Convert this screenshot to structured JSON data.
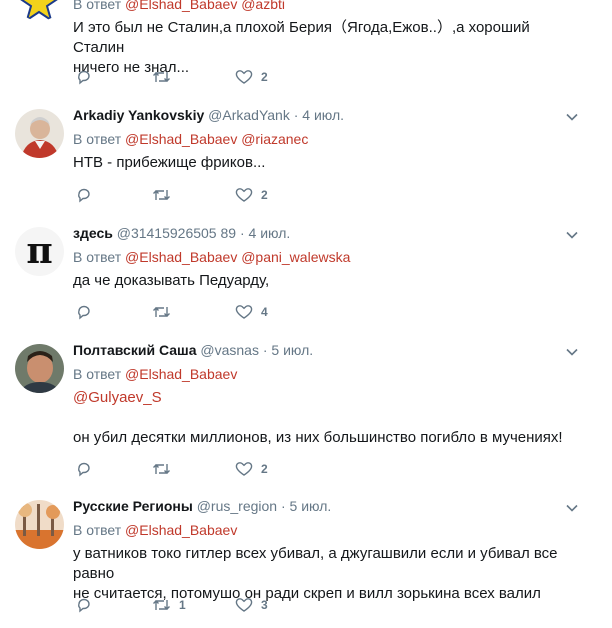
{
  "tweets": [
    {
      "name": "",
      "handle": "",
      "time": "",
      "reply_prefix": "В ответ",
      "reply_to": [
        "@Elshad_Babaev",
        "@azbti"
      ],
      "lines": [
        "И это был не Сталин,а плохой Берия（Ягода,Ежов..）,а хороший Сталин",
        "ничего не знал..."
      ],
      "replies": "",
      "retweets": "",
      "likes": "2",
      "avatar_icon": "yellow-star-emblem-icon"
    },
    {
      "name": "Arkadiy Yankovskiy",
      "handle": "@ArkadYank",
      "time": "4 июл.",
      "reply_prefix": "В ответ",
      "reply_to": [
        "@Elshad_Babaev",
        "@riazanec"
      ],
      "lines": [
        "НТВ - прибежище фриков..."
      ],
      "replies": "",
      "retweets": "",
      "likes": "2",
      "avatar_icon": "man-portrait-icon"
    },
    {
      "name": "здесь",
      "handle": "@31415926505 89",
      "time": "4 июл.",
      "reply_prefix": "В ответ",
      "reply_to": [
        "@Elshad_Babaev",
        "@pani_walewska"
      ],
      "lines": [
        "да че доказывать Педуарду,"
      ],
      "replies": "",
      "retweets": "",
      "likes": "4",
      "avatar_icon": "pi-symbol-icon"
    },
    {
      "name": "Полтавский Саша",
      "handle": "@vasnas",
      "time": "5 июл.",
      "reply_prefix": "В ответ",
      "reply_to": [
        "@Elshad_Babaev"
      ],
      "lines": [
        "@Gulyaev_S",
        "",
        "он убил десятки миллионов, из них большинство погибло в мучениях!"
      ],
      "replies": "",
      "retweets": "",
      "likes": "2",
      "avatar_icon": "man-portrait-icon"
    },
    {
      "name": "Русские Регионы",
      "handle": "@rus_region",
      "time": "5 июл.",
      "reply_prefix": "В ответ",
      "reply_to": [
        "@Elshad_Babaev"
      ],
      "lines": [
        "у ватников токо гитлер всех убивал, а джугашвили если и убивал все равно",
        "не считается, потомушо он ради скреп и вилл зорькина всех валил"
      ],
      "replies": "",
      "retweets": "1",
      "likes": "3",
      "avatar_icon": "autumn-forest-icon"
    }
  ],
  "colors": {
    "text": "#14171a",
    "secondary": "#657786",
    "mention": "#c0392b",
    "divider": "#e6ecf0"
  }
}
